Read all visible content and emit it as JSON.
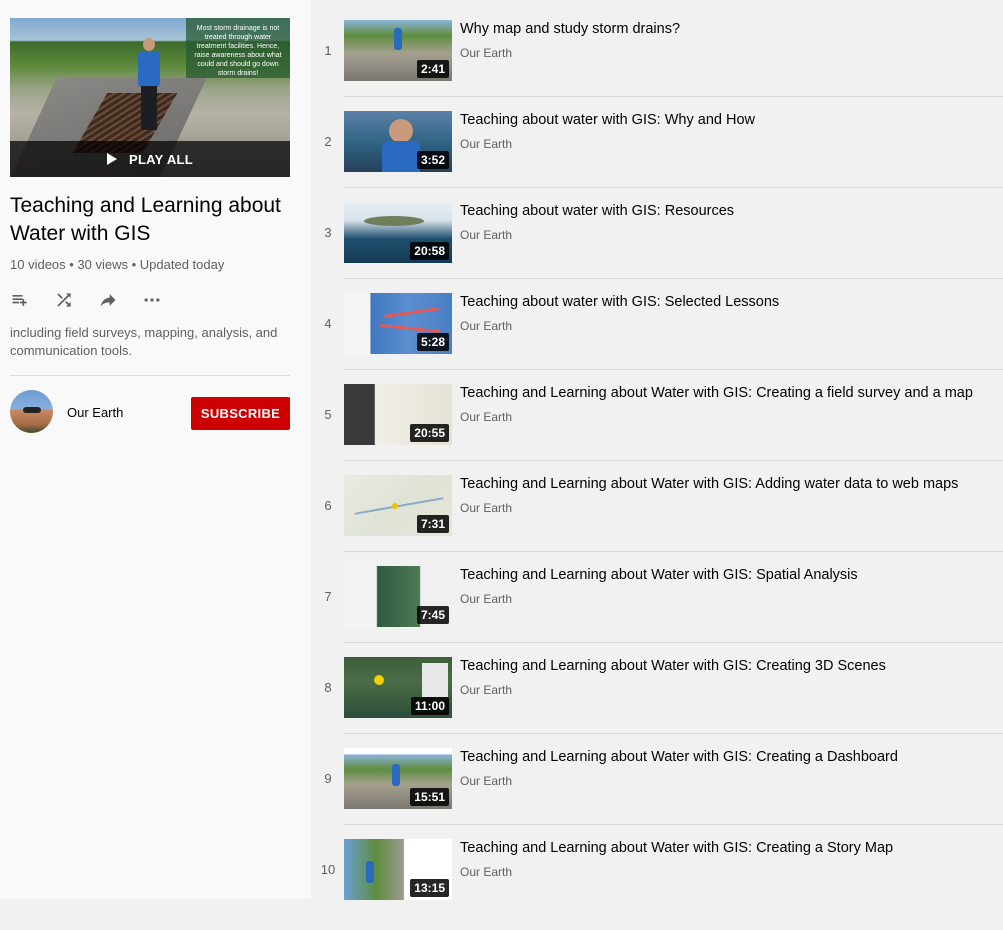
{
  "playlist": {
    "hero_overlay": "Most storm drainage is not treated through water treatment facilities. Hence, raise awareness about what could and should go down storm drains!",
    "play_all_label": "PLAY ALL",
    "title": "Teaching and Learning about Water with GIS",
    "stats": "10 videos • 30 views • Updated today",
    "description": "including field surveys, mapping, analysis, and communication tools."
  },
  "actions": [
    {
      "icon": "playlist-add-icon"
    },
    {
      "icon": "shuffle-icon"
    },
    {
      "icon": "share-icon"
    },
    {
      "icon": "more-icon"
    }
  ],
  "owner": {
    "channel_name": "Our Earth",
    "subscribe_label": "SUBSCRIBE"
  },
  "videos": [
    {
      "index": "1",
      "title": "Why map and study storm drains?",
      "channel": "Our Earth",
      "duration": "2:41"
    },
    {
      "index": "2",
      "title": "Teaching about water with GIS: Why and How",
      "channel": "Our Earth",
      "duration": "3:52"
    },
    {
      "index": "3",
      "title": "Teaching about water with GIS: Resources",
      "channel": "Our Earth",
      "duration": "20:58"
    },
    {
      "index": "4",
      "title": "Teaching about water with GIS: Selected Lessons",
      "channel": "Our Earth",
      "duration": "5:28"
    },
    {
      "index": "5",
      "title": "Teaching and Learning about Water with GIS: Creating a field survey and a map",
      "channel": "Our Earth",
      "duration": "20:55"
    },
    {
      "index": "6",
      "title": "Teaching and Learning about Water with GIS: Adding water data to web maps",
      "channel": "Our Earth",
      "duration": "7:31"
    },
    {
      "index": "7",
      "title": "Teaching and Learning about Water with GIS: Spatial Analysis",
      "channel": "Our Earth",
      "duration": "7:45"
    },
    {
      "index": "8",
      "title": "Teaching and Learning about Water with GIS: Creating 3D Scenes",
      "channel": "Our Earth",
      "duration": "11:00"
    },
    {
      "index": "9",
      "title": "Teaching and Learning about Water with GIS: Creating a Dashboard",
      "channel": "Our Earth",
      "duration": "15:51"
    },
    {
      "index": "10",
      "title": "Teaching and Learning about Water with GIS: Creating a Story Map",
      "channel": "Our Earth",
      "duration": "13:15"
    }
  ],
  "colors": {
    "subscribe": "#cc0000",
    "secondary_text": "#606060",
    "background": "#f1f1f1"
  }
}
